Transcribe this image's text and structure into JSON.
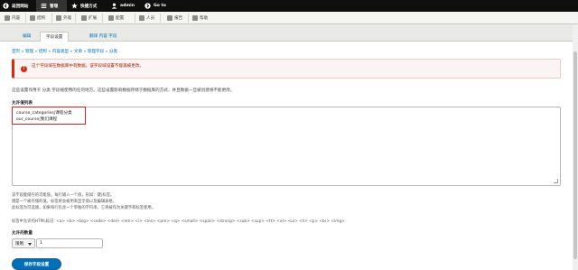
{
  "toolbar": {
    "back_label": "返回网站",
    "manage_label": "管理",
    "shortcuts_label": "快捷方式",
    "user_label": "admin",
    "goto_label": "Go to"
  },
  "admin_menu": [
    {
      "label": "内容"
    },
    {
      "label": "结构"
    },
    {
      "label": "外观"
    },
    {
      "label": "扩展"
    },
    {
      "label": "配置"
    },
    {
      "label": "人员"
    },
    {
      "label": "报告"
    },
    {
      "label": "帮助"
    }
  ],
  "tabs": [
    {
      "label": "编辑"
    },
    {
      "label": "字段设置"
    },
    {
      "label": "翻译 内容 字段"
    }
  ],
  "breadcrumb": "首页 » 管理 » 结构 » 内容类型 » 文章 » 管理字段 » 分类",
  "alert": {
    "line1": "这个字段域在数据库中有数据。该字段域设置不能再被更改。"
  },
  "description": "这些设置作用于 分类 字段被使用的任何地方。这些设置影响数据存储于数据库的方式，并且数据一旦被创建将不能更改。",
  "allowed_values": {
    "label": "允许值列表",
    "lines": [
      "course_categories|课程分类",
      "our_course|我们课程"
    ]
  },
  "help": {
    "line1": "该字段能储存的可能值。每行输入一个值，形如：键|标签。",
    "line2": "键是一个被存储的值。标签将会被用来显示值以及编辑表格。",
    "line3": "此标签为可选填，如果每行包含一个单独的字符串，它将被作为关键字和标签使用。",
    "line4": "标签中允许的HTML标记: <a> <b> <big> <code> <del> <em> <i> <ins> <pre> <q> <small> <span> <strong> <sub> <sup> <tt> <ol> <ul> <li> <p> <br> <img>"
  },
  "cardinality": {
    "label": "允许的数量",
    "select_value": "限制",
    "number_value": "1"
  },
  "save_label": "保存字段设置"
}
